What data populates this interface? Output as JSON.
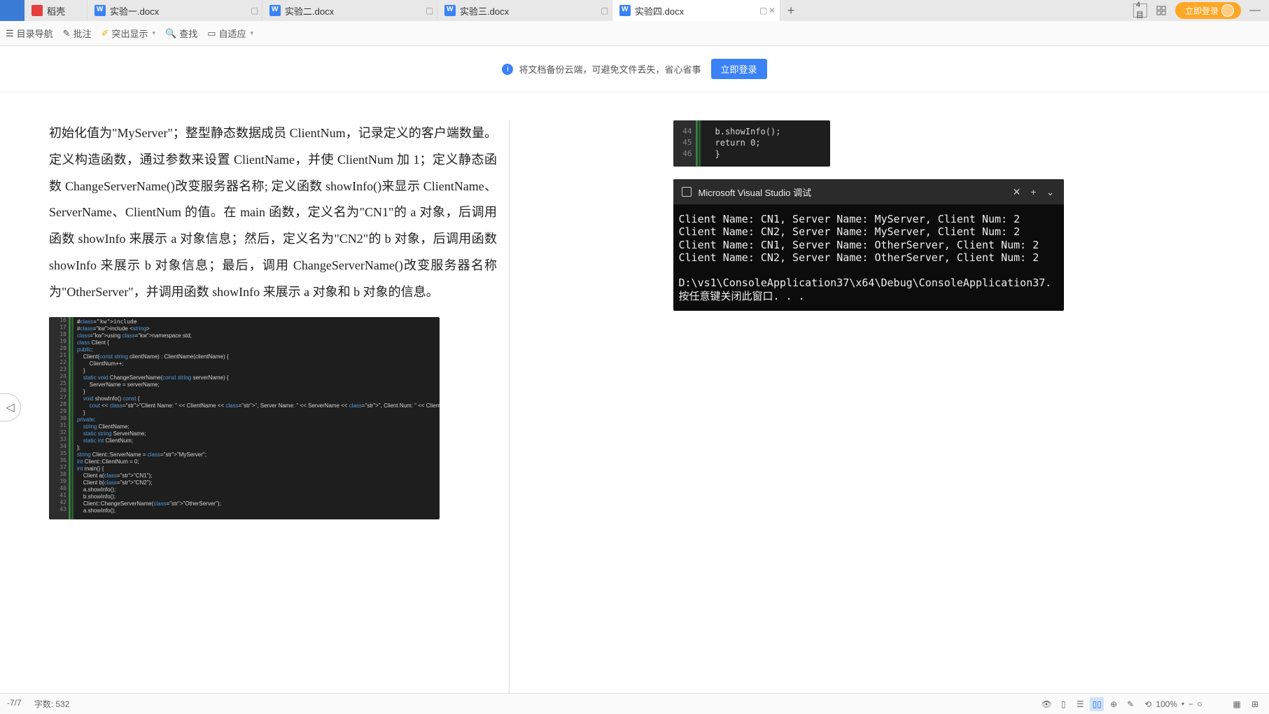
{
  "tabs": [
    {
      "label": "稻壳",
      "iconType": "red"
    },
    {
      "label": "实验一.docx",
      "iconType": "blue"
    },
    {
      "label": "实验二.docx",
      "iconType": "blue"
    },
    {
      "label": "实验三.docx",
      "iconType": "blue"
    },
    {
      "label": "实验四.docx",
      "iconType": "blue",
      "active": true
    }
  ],
  "topIcons": {
    "pageIndicator": "4目",
    "loginLabel": "立即登录"
  },
  "toolbar": {
    "nav": "目录导航",
    "comment": "批注",
    "highlight": "突出显示",
    "search": "查找",
    "fit": "自适应"
  },
  "banner": {
    "text": "将文档备份云端，可避免文件丢失，省心省事",
    "button": "立即登录"
  },
  "docText": "初始化值为\"MyServer\"；整型静态数据成员 ClientNum，记录定义的客户端数量。定义构造函数，通过参数来设置 ClientName，并使 ClientNum 加 1；定义静态函数 ChangeServerName()改变服务器名称; 定义函数 showInfo()来显示 ClientName、ServerName、ClientNum 的值。在 main 函数，定义名为\"CN1\"的 a 对象，后调用函数 showInfo 来展示 a 对象信息；然后，定义名为\"CN2\"的 b 对象，后调用函数 showInfo 来展示 b 对象信息；最后，调用 ChangeServerName()改变服务器名称为\"OtherServer\"，并调用函数 showInfo 来展示 a 对象和 b 对象的信息。",
  "codeGutterStart": 16,
  "codeLines": [
    "#include <iostream>",
    "#include <string>",
    "using namespace std;",
    "class Client {",
    "public:",
    "    Client(const string clientName) : ClientName(clientName) {",
    "        ClientNum++;",
    "    }",
    "    static void ChangeServerName(const string serverName) {",
    "        ServerName = serverName;",
    "    }",
    "    void showInfo() const {",
    "        cout << \"Client Name: \" << ClientName << \", Server Name: \" << ServerName << \", Client Num: \" << ClientNum << endl;",
    "    }",
    "private:",
    "    string ClientName;",
    "    static string ServerName;",
    "    static int ClientNum;",
    "};",
    "string Client::ServerName = \"MyServer\";",
    "int Client::ClientNum = 0;",
    "int main() {",
    "    Client a(\"CN1\");",
    "    Client b(\"CN2\");",
    "    a.showInfo();",
    "    b.showInfo();",
    "    Client::ChangeServerName(\"OtherServer\");",
    "    a.showInfo();"
  ],
  "snipGutter": [
    "44",
    "45",
    "46"
  ],
  "snipCode": "b.showInfo();\nreturn 0;\n}",
  "terminal": {
    "title": "Microsoft Visual Studio 调试",
    "lines": [
      "Client Name: CN1, Server Name: MyServer, Client Num: 2",
      "Client Name: CN2, Server Name: MyServer, Client Num: 2",
      "Client Name: CN1, Server Name: OtherServer, Client Num: 2",
      "Client Name: CN2, Server Name: OtherServer, Client Num: 2",
      "",
      "D:\\vs1\\ConsoleApplication37\\x64\\Debug\\ConsoleApplication37.",
      "按任意键关闭此窗口. . ."
    ]
  },
  "statusBar": {
    "page": "-7/7",
    "wordCount": "字数: 532",
    "zoom": "100%"
  }
}
